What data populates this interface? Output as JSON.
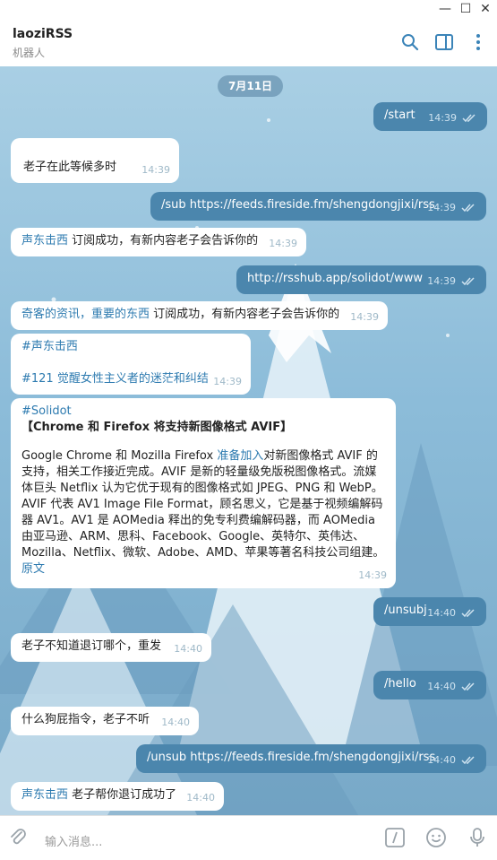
{
  "window": {
    "minimize": "—",
    "maximize": "☐",
    "close": "✕"
  },
  "header": {
    "title": "laoziRSS",
    "subtitle": "机器人"
  },
  "chat": {
    "date": "7月11日",
    "messages": [
      {
        "side": "out",
        "text": "/start",
        "time": "14:39"
      },
      {
        "side": "in",
        "text": "老子在此等候多时",
        "time": "14:39"
      },
      {
        "side": "out",
        "text": "/sub https://feeds.fireside.fm/shengdongjixi/rss",
        "time": "14:39"
      },
      {
        "side": "in",
        "link": "声东击西",
        "text": " 订阅成功，有新内容老子会告诉你的",
        "time": "14:39"
      },
      {
        "side": "out",
        "text": "http://rsshub.app/solidot/www",
        "time": "14:39"
      },
      {
        "side": "in",
        "link": "奇客的资讯，重要的东西",
        "text": " 订阅成功，有新内容老子会告诉你的",
        "time": "14:39"
      },
      {
        "side": "in",
        "tag": "#声东击西",
        "text2": "#121 觉醒女性主义者的迷茫和纠结",
        "time": "14:39"
      },
      {
        "side": "in",
        "tag": "#Solidot",
        "headline": "【Chrome 和 Firefox 将支持新图像格式 AVIF】",
        "body_pre": " Google Chrome 和 Mozilla Firefox ",
        "body_link": "准备加入",
        "body_post": "对新图像格式 AVIF 的支持，相关工作接近完成。AVIF 是新的轻量级免版税图像格式。流媒体巨头 Netflix 认为它优于现有的图像格式如 JPEG、PNG 和 WebP。AVIF 代表 AV1 Image File Format，顾名思义，它是基于视频编解码器 AV1。AV1 是 AOMedia 释出的免专利费编解码器，而 AOMedia 由亚马逊、ARM、思科、Facebook、Google、英特尔、英伟达、Mozilla、Netflix、微软、Adobe、AMD、苹果等著名科技公司组建。",
        "source": "原文",
        "time": "14:39"
      },
      {
        "side": "out",
        "text": "/unsubj",
        "time": "14:40"
      },
      {
        "side": "in",
        "text": "老子不知道退订哪个，重发",
        "time": "14:40"
      },
      {
        "side": "out",
        "text": "/hello",
        "time": "14:40"
      },
      {
        "side": "in",
        "text": "什么狗屁指令，老子不听",
        "time": "14:40"
      },
      {
        "side": "out",
        "text": "/unsub https://feeds.fireside.fm/shengdongjixi/rss",
        "time": "14:40"
      },
      {
        "side": "in",
        "link": "声东击西",
        "text": " 老子帮你退订成功了",
        "time": "14:40"
      }
    ]
  },
  "footer": {
    "placeholder": "输入消息..."
  },
  "icons": {
    "search": "search-icon",
    "sidebar": "sidebar-toggle-icon",
    "more": "more-vertical-icon",
    "attach": "paperclip-icon",
    "commands": "bot-commands-icon",
    "emoji": "emoji-icon",
    "mic": "microphone-icon"
  },
  "colors": {
    "outgoing": "#4b86ad",
    "incoming": "#ffffff",
    "link": "#2e7bb0",
    "accent": "#3b84b8"
  }
}
